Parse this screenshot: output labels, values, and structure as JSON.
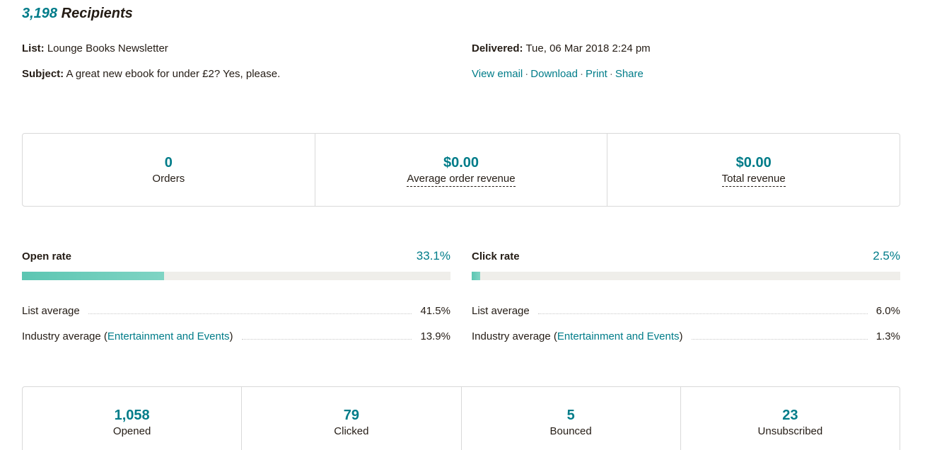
{
  "header": {
    "recipient_count": "3,198",
    "recipient_label": "Recipients"
  },
  "meta": {
    "list_label": "List:",
    "list_value": "Lounge Books Newsletter",
    "subject_label": "Subject:",
    "subject_value": "A great new ebook for under £2? Yes, please.",
    "delivered_label": "Delivered:",
    "delivered_value": "Tue, 06 Mar 2018 2:24 pm",
    "actions": [
      "View email",
      "Download",
      "Print",
      "Share"
    ]
  },
  "revenue": {
    "orders_value": "0",
    "orders_label": "Orders",
    "avg_order_value": "$0.00",
    "avg_order_label": "Average order revenue",
    "total_value": "$0.00",
    "total_label": "Total revenue"
  },
  "open_rate": {
    "title": "Open rate",
    "value": "33.1%",
    "fraction": 0.331,
    "list_avg_label": "List average",
    "list_avg_value": "41.5%",
    "industry_label_prefix": "Industry average (",
    "industry_link": "Entertainment and Events",
    "industry_label_suffix": ")",
    "industry_value": "13.9%"
  },
  "click_rate": {
    "title": "Click rate",
    "value": "2.5%",
    "fraction": 0.02,
    "list_avg_label": "List average",
    "list_avg_value": "6.0%",
    "industry_label_prefix": "Industry average (",
    "industry_link": "Entertainment and Events",
    "industry_label_suffix": ")",
    "industry_value": "1.3%"
  },
  "stats": {
    "opened_value": "1,058",
    "opened_label": "Opened",
    "clicked_value": "79",
    "clicked_label": "Clicked",
    "bounced_value": "5",
    "bounced_label": "Bounced",
    "unsub_value": "23",
    "unsub_label": "Unsubscribed"
  },
  "colors": {
    "accent": "#007c89",
    "bar_fill": "#5cc6b2",
    "bar_track": "#efeeea",
    "border": "#d9d9d9"
  }
}
